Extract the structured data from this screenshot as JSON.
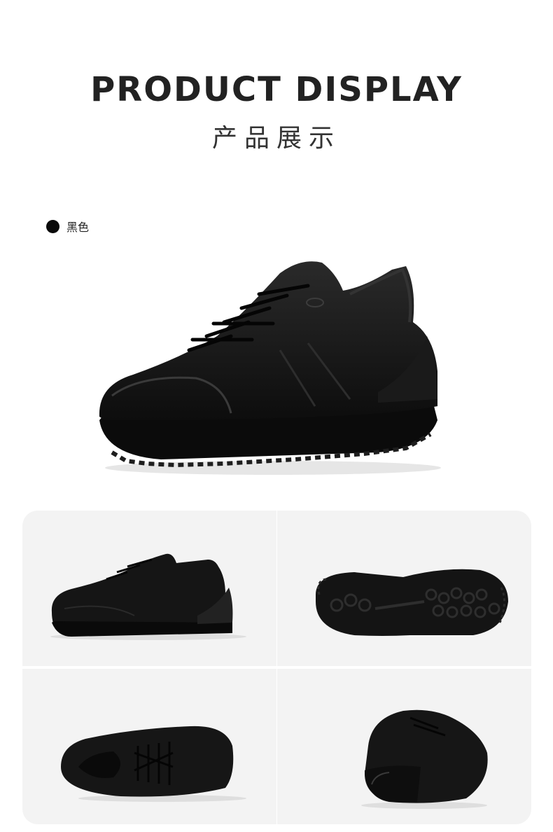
{
  "header": {
    "title": "PRODUCT DISPLAY",
    "subtitle": "产品展示"
  },
  "color_option": {
    "label": "黑色",
    "swatch_color": "#0a0a0a"
  },
  "colors": {
    "shoe": "#111111",
    "panel_bg": "#f3f3f3"
  },
  "views": [
    {
      "view": "side-view",
      "icon": "shoe-side-icon"
    },
    {
      "view": "sole-view",
      "icon": "shoe-sole-icon"
    },
    {
      "view": "top-view",
      "icon": "shoe-top-icon"
    },
    {
      "view": "back-view",
      "icon": "shoe-back-icon"
    }
  ]
}
